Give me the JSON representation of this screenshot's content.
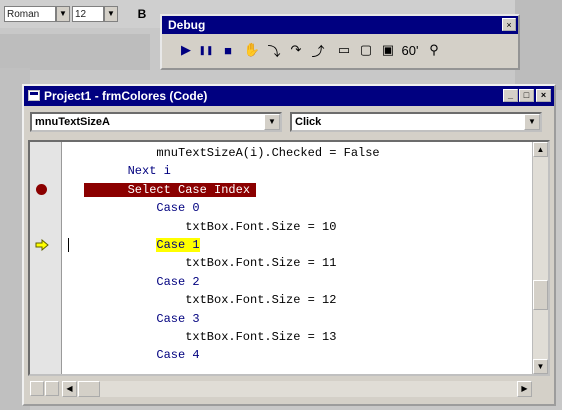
{
  "toolbar": {
    "font_name": "Roman",
    "font_size": "12",
    "bold_label": "B"
  },
  "debug_toolbar": {
    "title": "Debug",
    "close_label": "×",
    "buttons": [
      {
        "name": "run-icon",
        "glyph": "▶"
      },
      {
        "name": "break-icon",
        "glyph": "❚❚"
      },
      {
        "name": "stop-icon",
        "glyph": "■"
      },
      {
        "name": "toggle-breakpoint-icon",
        "glyph": "✋"
      },
      {
        "name": "step-into-icon",
        "glyph": "⤵"
      },
      {
        "name": "step-over-icon",
        "glyph": "↷"
      },
      {
        "name": "step-out-icon",
        "glyph": "⤴"
      },
      {
        "name": "locals-window-icon",
        "glyph": "▭"
      },
      {
        "name": "immediate-window-icon",
        "glyph": "▢"
      },
      {
        "name": "watch-window-icon",
        "glyph": "▣"
      },
      {
        "name": "quick-watch-icon",
        "glyph": "60'"
      },
      {
        "name": "call-stack-icon",
        "glyph": "⚲"
      }
    ]
  },
  "code_window": {
    "title": "Project1 - frmColores (Code)",
    "object_combo": "mnuTextSizeA",
    "procedure_combo": "Click",
    "lines": [
      {
        "text": "mnuTextSizeA(i).Checked = False",
        "indent": 12,
        "style": "plain"
      },
      {
        "text": "Next i",
        "indent": 8,
        "style": "kw"
      },
      {
        "text": "Select Case Index",
        "indent": 8,
        "style": "breakpoint"
      },
      {
        "text": "Case 0",
        "indent": 12,
        "style": "kw"
      },
      {
        "text": "txtBox.Font.Size = 10",
        "indent": 16,
        "style": "plain"
      },
      {
        "text": "Case 1",
        "indent": 12,
        "style": "exec"
      },
      {
        "text": "txtBox.Font.Size = 11",
        "indent": 16,
        "style": "plain"
      },
      {
        "text": "Case 2",
        "indent": 12,
        "style": "kw"
      },
      {
        "text": "txtBox.Font.Size = 12",
        "indent": 16,
        "style": "plain"
      },
      {
        "text": "Case 3",
        "indent": 12,
        "style": "kw"
      },
      {
        "text": "txtBox.Font.Size = 13",
        "indent": 16,
        "style": "plain"
      },
      {
        "text": "Case 4",
        "indent": 12,
        "style": "kw"
      }
    ],
    "breakpoint_line": 2,
    "current_line": 5
  },
  "colors": {
    "title_bar": "#000080",
    "breakpoint": "#8b0000",
    "exec_highlight": "#ffff00",
    "keyword": "#00007f"
  }
}
